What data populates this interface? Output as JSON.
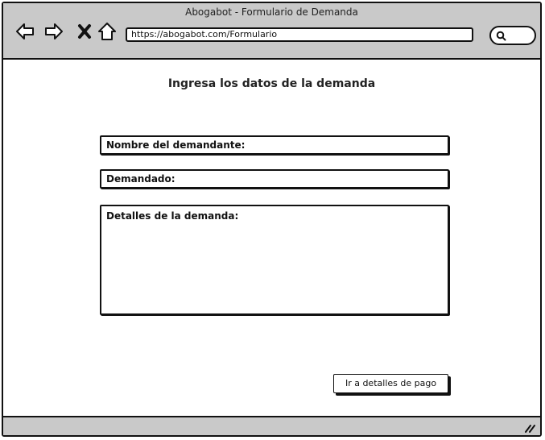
{
  "window": {
    "title": "Abogabot - Formulario de Demanda",
    "url": "https://abogabot.com/Formulario",
    "icons": [
      "back-arrow-icon",
      "forward-arrow-icon",
      "close-icon",
      "home-icon",
      "search-icon"
    ]
  },
  "form": {
    "heading": "Ingresa los datos de la demanda",
    "plaintiff_label": "Nombre del demandante:",
    "defendant_label": "Demandado:",
    "details_label": "Detalles de la demanda:",
    "submit_label": "Ir a detalles de pago"
  },
  "colors": {
    "bar_background": "#c9c9c9",
    "outline": "#111111"
  }
}
